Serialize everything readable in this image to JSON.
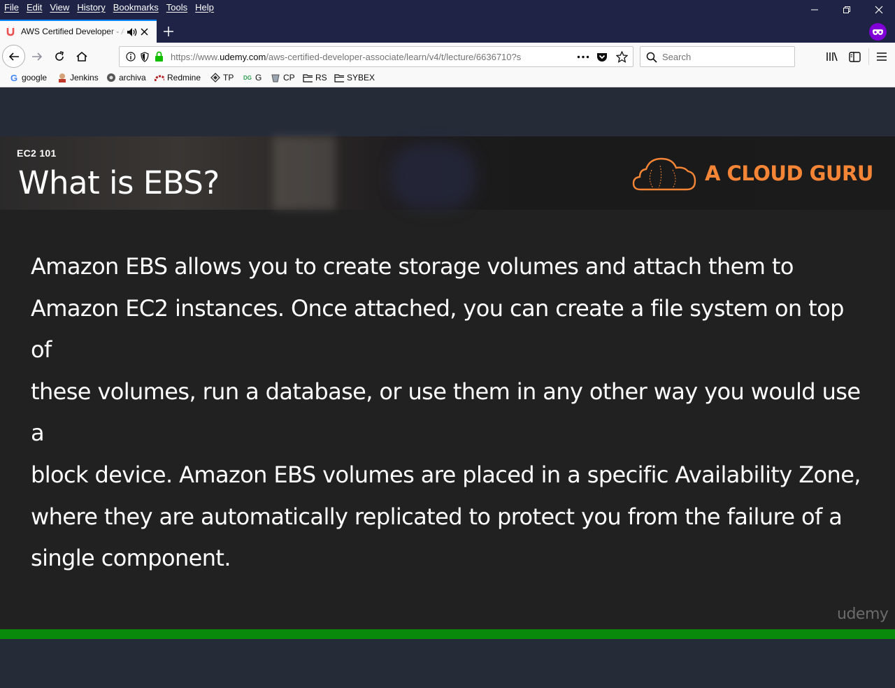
{
  "menu": {
    "items": [
      "File",
      "Edit",
      "View",
      "History",
      "Bookmarks",
      "Tools",
      "Help"
    ]
  },
  "window_controls": {
    "minimize_icon": "minimize-icon",
    "restore_icon": "restore-icon",
    "close_icon": "close-icon"
  },
  "tab": {
    "title": "AWS Certified Developer - A",
    "favicon": "udemy-icon",
    "audio_icon": "speaker-icon",
    "close_icon": "close-icon"
  },
  "nav": {
    "url_prefix": "https://www.",
    "url_host": "udemy.com",
    "url_path": "/aws-certified-developer-associate/learn/v4/t/lecture/6636710?s",
    "search_placeholder": "Search"
  },
  "bookmarks": [
    {
      "label": "google",
      "icon": "google-icon"
    },
    {
      "label": "Jenkins",
      "icon": "jenkins-icon"
    },
    {
      "label": "archiva",
      "icon": "archiva-icon"
    },
    {
      "label": "Redmine",
      "icon": "redmine-icon"
    },
    {
      "label": "TP",
      "icon": "diamond-icon"
    },
    {
      "label": "G",
      "icon": "g-icon"
    },
    {
      "label": "CP",
      "icon": "cp-icon"
    },
    {
      "label": "RS",
      "icon": "folder-icon"
    },
    {
      "label": "SYBEX",
      "icon": "folder-icon"
    }
  ],
  "slide": {
    "kicker": "EC2 101",
    "title": "What is EBS?",
    "brand": "A CLOUD GURU",
    "lines": [
      "Amazon EBS allows you to create storage volumes and attach them to",
      "Amazon EC2 instances. Once attached, you can create a file system on top of",
      "these volumes, run a database, or use them in any other way you would use a",
      "block device. Amazon EBS volumes are placed in a specific Availability Zone,",
      "where they are automatically replicated to protect you from the failure of a",
      "single component."
    ],
    "watermark": "udemy"
  },
  "video": {
    "progress_percent": 100
  },
  "colors": {
    "brand_orange": "#f58536",
    "progress_green": "#0a8a0a",
    "toolbar_dark": "#1f2447"
  }
}
